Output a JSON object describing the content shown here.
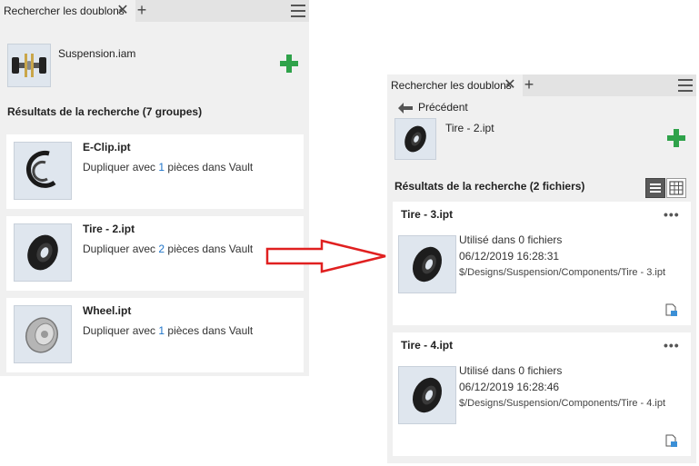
{
  "left_panel": {
    "tab_label": "Rechercher les doublons",
    "assembly_name": "Suspension.iam",
    "results_heading": "Résultats de la recherche (7 groupes)",
    "groups": [
      {
        "name": "E-Clip.ipt",
        "prefix": "Dupliquer avec ",
        "count": "1",
        "suffix": " pièces dans Vault"
      },
      {
        "name": "Tire - 2.ipt",
        "prefix": "Dupliquer avec ",
        "count": "2",
        "suffix": " pièces dans Vault"
      },
      {
        "name": "Wheel.ipt",
        "prefix": "Dupliquer avec ",
        "count": "1",
        "suffix": " pièces dans Vault"
      }
    ]
  },
  "right_panel": {
    "tab_label": "Rechercher les doublons",
    "back_label": "Précédent",
    "part_name": "Tire - 2.ipt",
    "results_heading": "Résultats de la recherche (2 fichiers)",
    "files": [
      {
        "name": "Tire - 3.ipt",
        "usage": "Utilisé dans 0 fichiers",
        "date": "06/12/2019 16:28:31",
        "path": "$/Designs/Suspension/Components/Tire - 3.ipt"
      },
      {
        "name": "Tire - 4.ipt",
        "usage": "Utilisé dans 0 fichiers",
        "date": "06/12/2019 16:28:46",
        "path": "$/Designs/Suspension/Components/Tire - 4.ipt"
      }
    ],
    "more_label": "•••"
  },
  "icons": {
    "close": "close-icon",
    "add": "plus-icon",
    "menu": "hamburger-menu-icon",
    "back": "arrow-left-icon",
    "place": "green-plus-icon",
    "view_list": "list-view-icon",
    "view_grid": "grid-view-icon",
    "open_doc": "document-open-icon",
    "flow_arrow": "red-arrow-icon"
  },
  "colors": {
    "accent_count": "#1e73c8",
    "add_green": "#2fa24a",
    "flow_arrow": "#e02020"
  }
}
